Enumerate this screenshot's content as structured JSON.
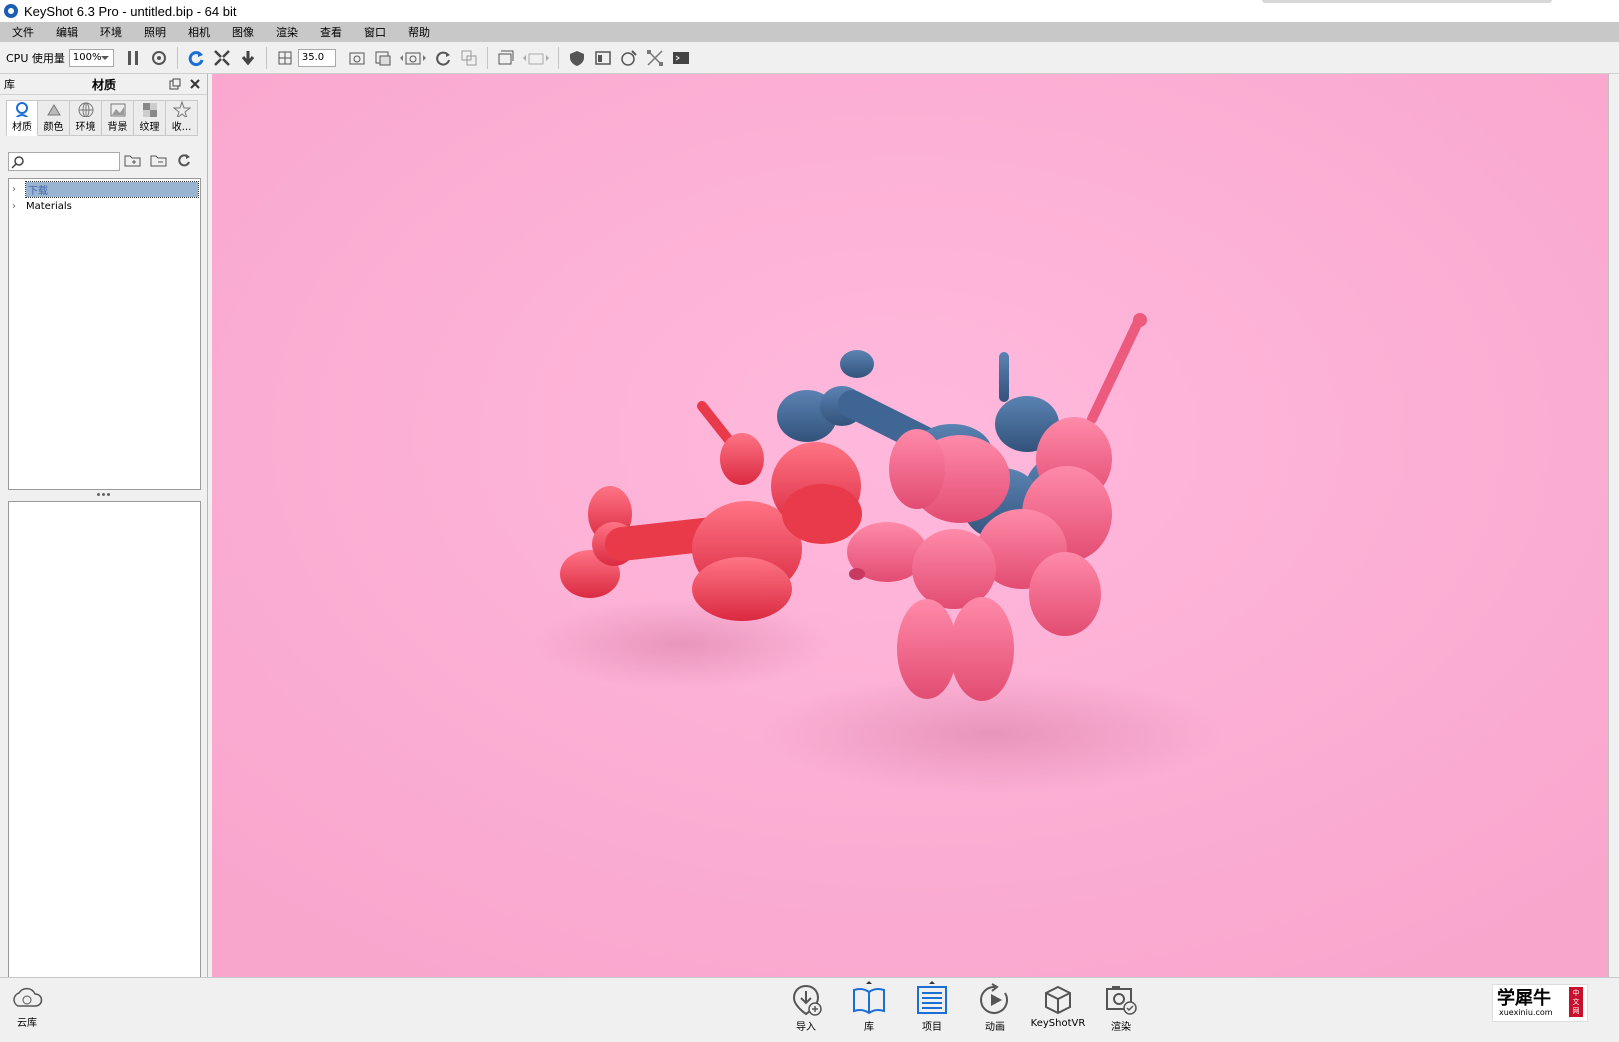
{
  "window": {
    "title": "KeyShot 6.3 Pro  - untitled.bip  - 64 bit"
  },
  "menu": [
    "文件",
    "编辑",
    "环境",
    "照明",
    "相机",
    "图像",
    "渲染",
    "查看",
    "窗口",
    "帮助"
  ],
  "toolbar": {
    "cpu_label": "CPU 使用量",
    "cpu_value": "100%",
    "focal_value": "35.0"
  },
  "library": {
    "header_label": "库",
    "title": "材质",
    "tabs": [
      {
        "label": "材质",
        "icon": "material-icon"
      },
      {
        "label": "颜色",
        "icon": "color-icon"
      },
      {
        "label": "环境",
        "icon": "environment-icon"
      },
      {
        "label": "背景",
        "icon": "background-icon"
      },
      {
        "label": "纹理",
        "icon": "texture-icon"
      },
      {
        "label": "收...",
        "icon": "favorites-icon"
      }
    ],
    "search": {
      "value": "",
      "placeholder": ""
    },
    "tree": [
      {
        "label": "下载",
        "selected": true
      },
      {
        "label": "Materials",
        "selected": false
      }
    ]
  },
  "viewport": {
    "background_color": "#fdacd3"
  },
  "bottom": {
    "cloud_label": "云库",
    "buttons": [
      {
        "label": "导入",
        "icon": "import-icon"
      },
      {
        "label": "库",
        "icon": "library-book-icon"
      },
      {
        "label": "项目",
        "icon": "project-list-icon"
      },
      {
        "label": "动画",
        "icon": "animation-icon"
      },
      {
        "label": "KeyShotVR",
        "icon": "keyshotvr-icon"
      },
      {
        "label": "渲染",
        "icon": "render-icon"
      }
    ],
    "watermark": {
      "main": "学犀牛",
      "sub": "xuexiniu.com",
      "side": "中文网"
    }
  },
  "colors": {
    "accent": "#1a5fb4",
    "viewport_bg": "#fdacd3",
    "balloon_red": "#e8303f",
    "balloon_blue": "#2f5f8f",
    "balloon_pink": "#ec5a7e"
  }
}
